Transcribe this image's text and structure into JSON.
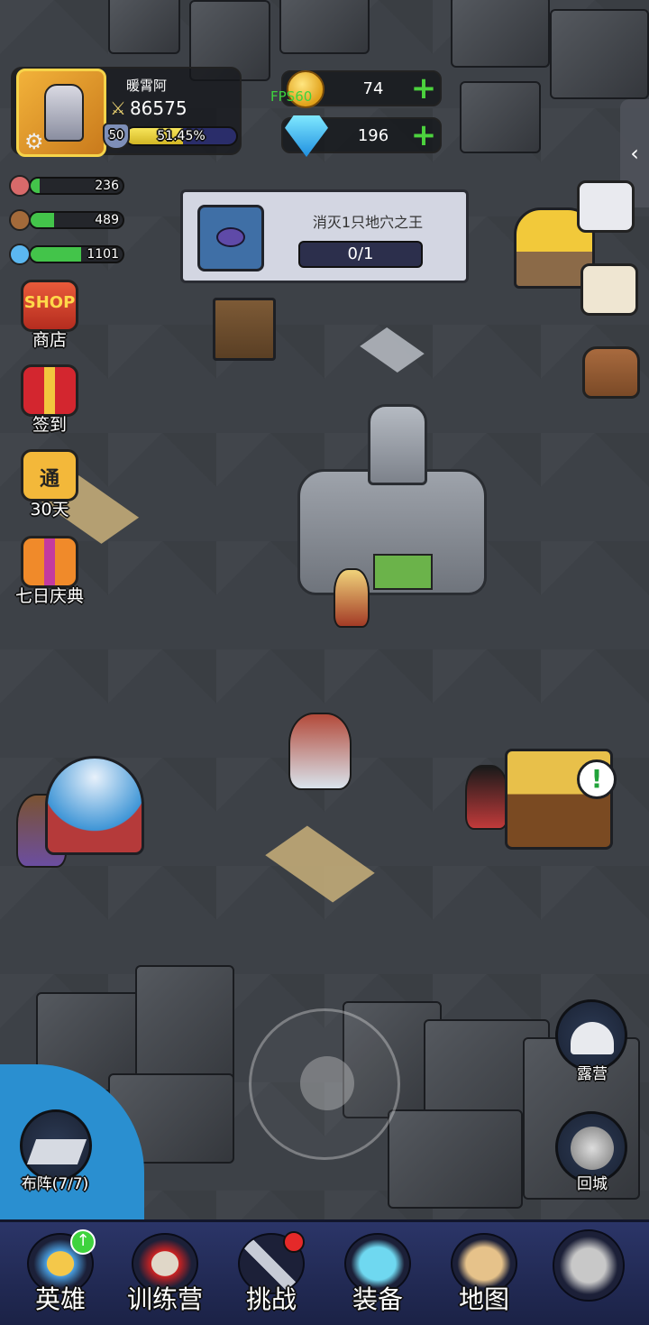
{
  "profile": {
    "name": "暖霄阿",
    "power": "86575",
    "level": "50",
    "xp_percent": "51.45%",
    "xp_fraction": 0.5145,
    "settings_icon": "gear-icon"
  },
  "currency": {
    "gold": "74",
    "diamonds": "196",
    "fps": "FPS60",
    "add_symbol": "+"
  },
  "resources": [
    {
      "name": "meat",
      "value": "236",
      "fill": 0.1,
      "color": "#d86a6a"
    },
    {
      "name": "wood",
      "value": "489",
      "fill": 0.25,
      "color": "#a36a3a"
    },
    {
      "name": "crystal",
      "value": "1101",
      "fill": 0.55,
      "color": "#5bb7f0"
    }
  ],
  "quest": {
    "title": "消灭1只地穴之王",
    "progress": "0/1",
    "icon": "spider-icon"
  },
  "left_buttons": {
    "shop": {
      "icon_text": "SHOP",
      "label": "商店"
    },
    "checkin": {
      "label": "签到"
    },
    "pass": {
      "icon_text": "通",
      "label": "30天"
    },
    "celebration": {
      "label": "七日庆典"
    }
  },
  "right_panel": {
    "toggle": "‹"
  },
  "map_buttons": {
    "formation": "布阵(7/7)",
    "camp": "露营",
    "return_town": "回城"
  },
  "nav": [
    {
      "label": "英雄",
      "badge": "↑"
    },
    {
      "label": "训练营"
    },
    {
      "label": "挑战",
      "badge": "red-dot"
    },
    {
      "label": "装备"
    },
    {
      "label": "地图"
    },
    {
      "label": ""
    }
  ],
  "colors": {
    "nav_bg": "#2b3568",
    "accent_green": "#3ed33e",
    "xp_yellow": "#f7e55a"
  }
}
